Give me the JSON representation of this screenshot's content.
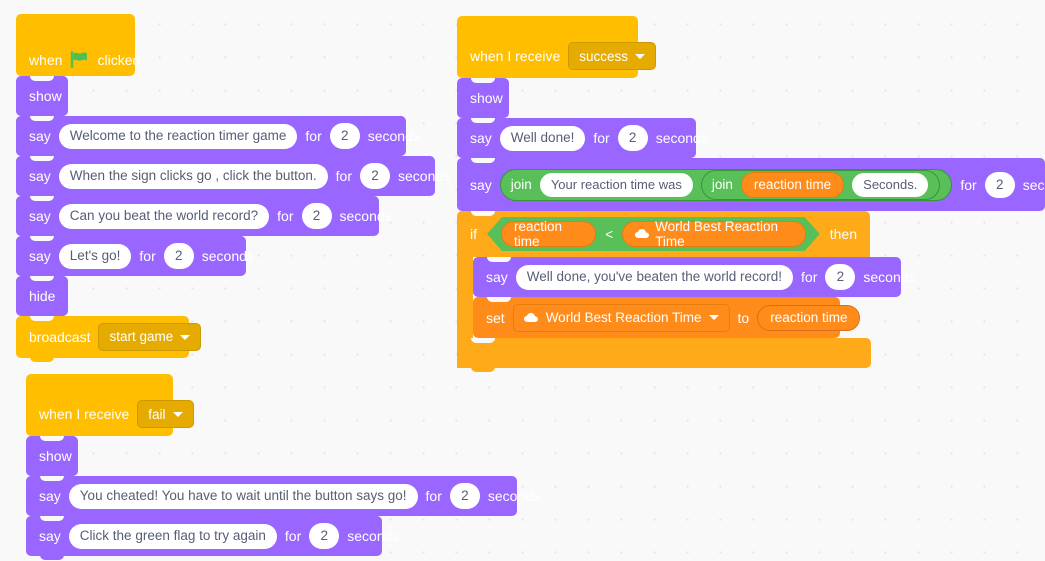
{
  "app": {
    "name": "Scratch block editor workspace",
    "background": "#f9f9f9",
    "colors": {
      "events": "#ffbf00",
      "looks": "#9966ff",
      "control": "#ffab19",
      "variables": "#ff8c1a",
      "operators": "#59c059",
      "flag_green": "#4cbf56",
      "input_text": "#575e75"
    }
  },
  "scripts": {
    "green_flag": {
      "hat": {
        "when": "when",
        "flag_icon": "green-flag-icon",
        "clicked": "clicked"
      },
      "blocks": [
        {
          "op": "show",
          "label": "show"
        },
        {
          "op": "say_for_secs",
          "say": "say",
          "message": "Welcome to the reaction timer game",
          "for": "for",
          "secs": "2",
          "seconds": "seconds"
        },
        {
          "op": "say_for_secs",
          "say": "say",
          "message": "When the sign clicks go , click the button.",
          "for": "for",
          "secs": "2",
          "seconds": "seconds"
        },
        {
          "op": "say_for_secs",
          "say": "say",
          "message": "Can you beat the world record?",
          "for": "for",
          "secs": "2",
          "seconds": "seconds"
        },
        {
          "op": "say_for_secs",
          "say": "say",
          "message": "Let's go!",
          "for": "for",
          "secs": "2",
          "seconds": "seconds"
        },
        {
          "op": "hide",
          "label": "hide"
        },
        {
          "op": "broadcast",
          "label": "broadcast",
          "message": "start game"
        }
      ]
    },
    "on_success": {
      "hat": {
        "label": "when I receive",
        "message": "success"
      },
      "show": "show",
      "say_well_done": {
        "say": "say",
        "message": "Well done!",
        "for": "for",
        "secs": "2",
        "seconds": "seconds"
      },
      "say_join": {
        "say": "say",
        "join_outer": "join",
        "text1": "Your reaction time was",
        "join_inner": "join",
        "variable": "reaction time",
        "text2": "Seconds.",
        "for": "for",
        "secs": "2",
        "seconds": "seconds"
      },
      "if_block": {
        "if": "if",
        "left": "reaction time",
        "operator": "<",
        "right": "World Best Reaction Time",
        "right_is_cloud": true,
        "then": "then",
        "body": [
          {
            "op": "say_for_secs",
            "say": "say",
            "message": "Well done, you've beaten the world record!",
            "for": "for",
            "secs": "2",
            "seconds": "seconds"
          },
          {
            "op": "set_var",
            "set": "set",
            "variable": "World Best Reaction Time",
            "variable_is_cloud": true,
            "to": "to",
            "value": "reaction time"
          }
        ]
      }
    },
    "on_fail": {
      "hat": {
        "label": "when I receive",
        "message": "fail"
      },
      "show": "show",
      "blocks": [
        {
          "op": "say_for_secs",
          "say": "say",
          "message": "You cheated! You have to wait until the button says go!",
          "for": "for",
          "secs": "2",
          "seconds": "seconds"
        },
        {
          "op": "say_for_secs",
          "say": "say",
          "message": "Click the green flag to try again",
          "for": "for",
          "secs": "2",
          "seconds": "seconds"
        }
      ]
    }
  }
}
